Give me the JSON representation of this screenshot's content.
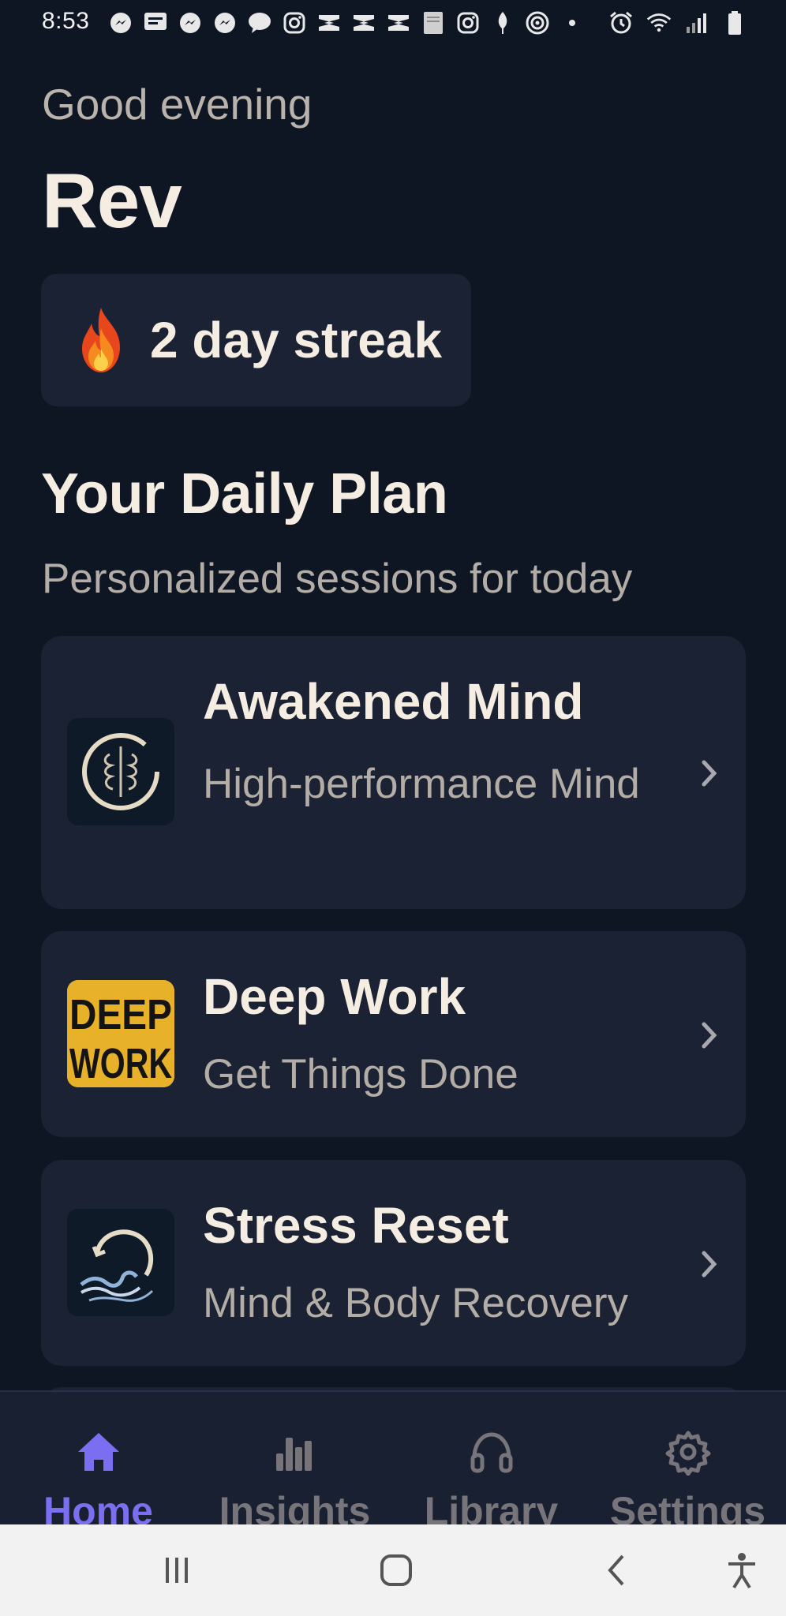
{
  "status_bar": {
    "time": "8:53",
    "left_icons": [
      "messenger-icon",
      "message-icon",
      "messenger-icon",
      "messenger-icon",
      "talk-icon",
      "instagram-icon",
      "capcut-icon",
      "capcut-icon",
      "capcut-icon",
      "bible-icon",
      "instagram-icon",
      "leaf-icon",
      "target-icon",
      "dot-icon"
    ],
    "right_icons": [
      "alarm-icon",
      "wifi-icon",
      "signal-icon",
      "battery-icon"
    ]
  },
  "header": {
    "greeting": "Good evening",
    "name": "Rev"
  },
  "streak": {
    "text": "2 day streak",
    "icon": "fire-icon"
  },
  "daily_plan": {
    "title": "Your Daily Plan",
    "subtitle": "Personalized sessions for today",
    "sessions": [
      {
        "title": "Awakened Mind",
        "subtitle": "High-performance Mind",
        "thumb": "awakened-mind-art"
      },
      {
        "title": "Deep Work",
        "subtitle": "Get Things Done",
        "thumb": "deep-work-art",
        "thumb_text_1": "DEEP",
        "thumb_text_2": "WORK"
      },
      {
        "title": "Stress Reset",
        "subtitle": "Mind & Body Recovery",
        "thumb": "stress-reset-art"
      }
    ]
  },
  "tab_bar": {
    "tabs": [
      {
        "label": "Home",
        "icon": "home-icon",
        "active": true
      },
      {
        "label": "Insights",
        "icon": "bar-chart-icon",
        "active": false
      },
      {
        "label": "Library",
        "icon": "headphones-icon",
        "active": false
      },
      {
        "label": "Settings",
        "icon": "gear-icon",
        "active": false
      }
    ]
  },
  "colors": {
    "background": "#0e1624",
    "card": "#1a2234",
    "accent": "#7c6ef0",
    "text_primary": "#f6ede2",
    "text_secondary": "#b3ada6"
  }
}
